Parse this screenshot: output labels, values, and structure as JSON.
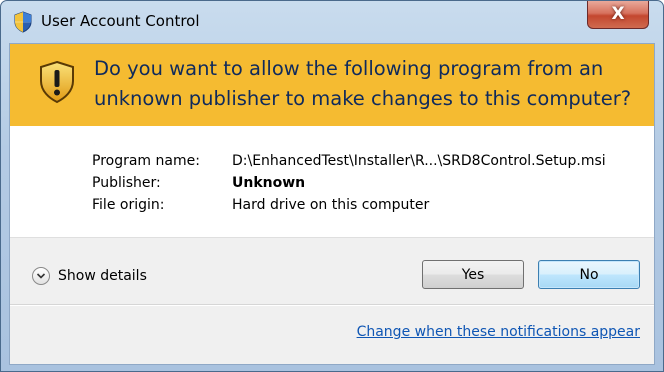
{
  "window": {
    "title": "User Account Control",
    "close_label": "X"
  },
  "banner": {
    "question": "Do you want to allow the following program from an unknown publisher to make changes to this computer?"
  },
  "details": {
    "program_name_label": "Program name:",
    "program_name_value": "D:\\EnhancedTest\\Installer\\R...\\SRD8Control.Setup.msi",
    "publisher_label": "Publisher:",
    "publisher_value": "Unknown",
    "file_origin_label": "File origin:",
    "file_origin_value": "Hard drive on this computer"
  },
  "footer": {
    "show_details_label": "Show details",
    "yes_label": "Yes",
    "no_label": "No",
    "notifications_link": "Change when these notifications appear"
  },
  "colors": {
    "banner": "#f5bb31",
    "banner_text": "#0f2a5c",
    "link": "#0f56b4",
    "default_button_border": "#3c7fb1"
  },
  "icons": {
    "title_icon": "uac-shield-icon",
    "banner_icon": "warning-shield-icon",
    "expand_icon": "chevron-down-icon"
  }
}
